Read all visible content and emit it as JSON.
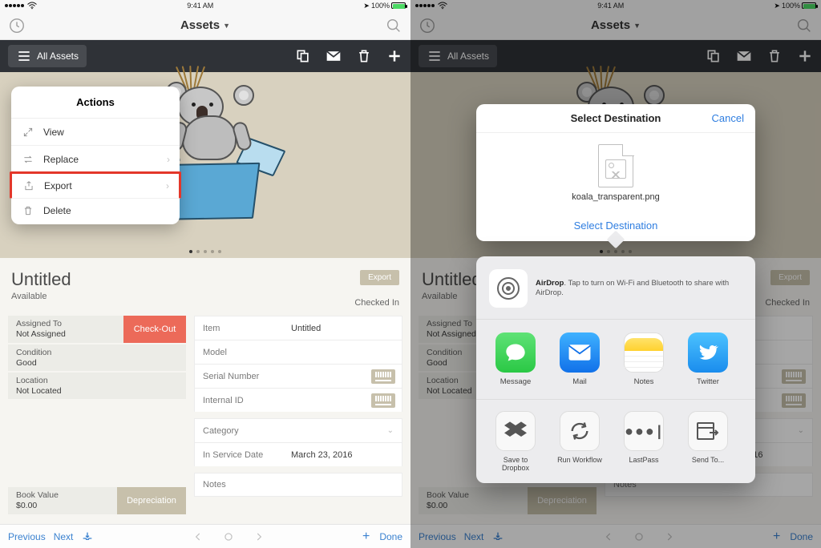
{
  "status": {
    "time": "9:41 AM",
    "batt": "100%"
  },
  "nav": {
    "title": "Assets"
  },
  "toolbar": {
    "filter": "All Assets"
  },
  "popover": {
    "title": "Actions",
    "view": "View",
    "replace": "Replace",
    "export": "Export",
    "delete": "Delete"
  },
  "record": {
    "title": "Untitled",
    "availability": "Available",
    "export_btn": "Export",
    "checked_in": "Checked In",
    "assigned_label": "Assigned To",
    "assigned_value": "Not Assigned",
    "checkout_btn": "Check-Out",
    "condition_label": "Condition",
    "condition_value": "Good",
    "location_label": "Location",
    "location_value": "Not Located",
    "book_label": "Book Value",
    "book_value": "$0.00",
    "dep_btn": "Depreciation",
    "item_label": "Item",
    "item_value": "Untitled",
    "model_label": "Model",
    "serial_label": "Serial Number",
    "internal_label": "Internal ID",
    "category_label": "Category",
    "service_label": "In Service Date",
    "service_value": "March 23, 2016",
    "notes_label": "Notes"
  },
  "bottom": {
    "prev": "Previous",
    "next": "Next",
    "done": "Done"
  },
  "share": {
    "title": "Select Destination",
    "cancel": "Cancel",
    "filename": "koala_transparent.png",
    "select_link": "Select Destination",
    "airdrop_title": "AirDrop",
    "airdrop_text": ". Tap to turn on Wi-Fi and Bluetooth to share with AirDrop.",
    "apps": {
      "message": "Message",
      "mail": "Mail",
      "notes": "Notes",
      "twitter": "Twitter"
    },
    "actions": {
      "dropbox": "Save to Dropbox",
      "workflow": "Run Workflow",
      "lastpass": "LastPass",
      "sendto": "Send To..."
    }
  }
}
